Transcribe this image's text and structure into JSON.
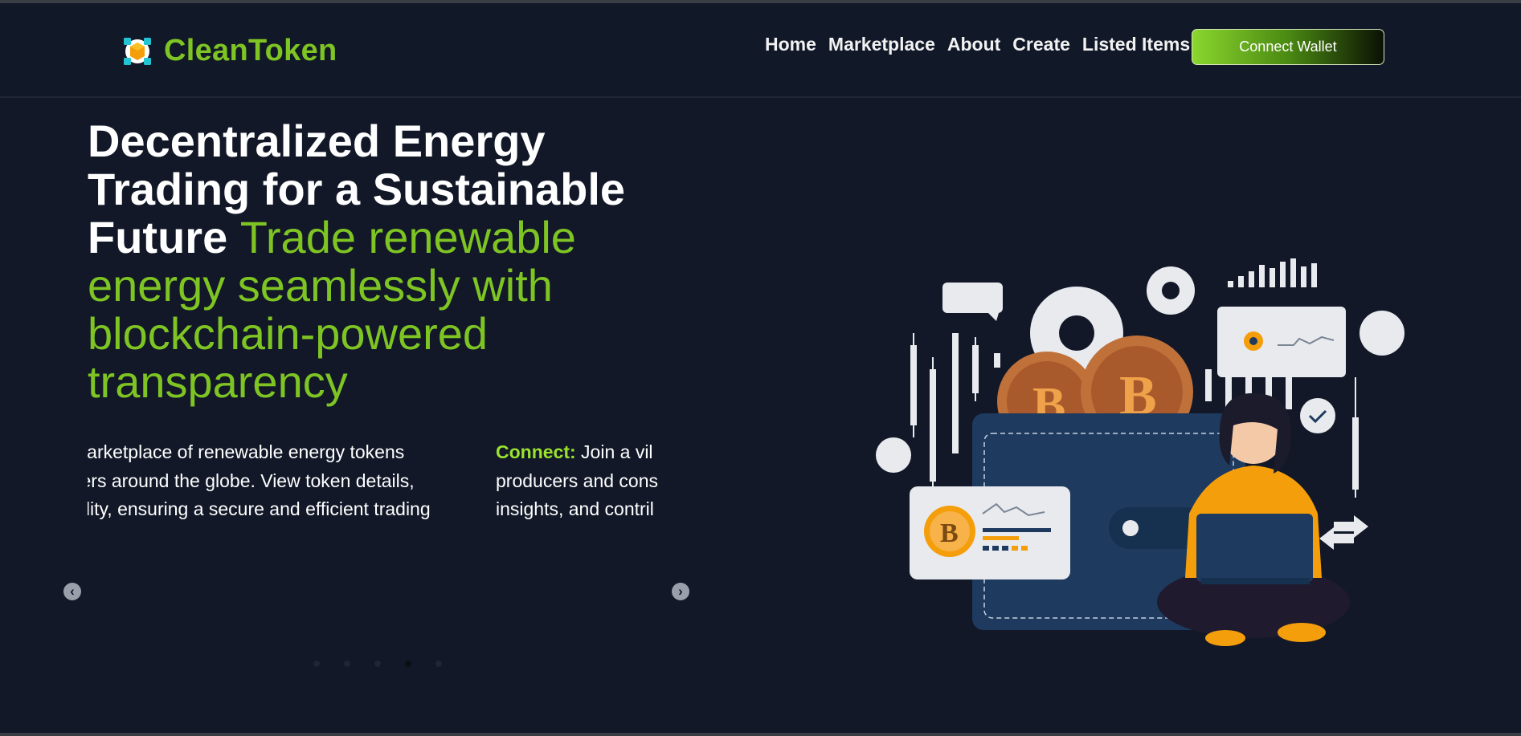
{
  "brand": {
    "name": "CleanToken",
    "icon": "hexagon-cube-icon",
    "color": "#7ec423"
  },
  "nav": {
    "items": [
      {
        "label": "Home"
      },
      {
        "label": "Marketplace"
      },
      {
        "label": "About"
      },
      {
        "label": "Create"
      },
      {
        "label": "Listed Items"
      }
    ],
    "wallet_button": "Connect Wallet"
  },
  "hero": {
    "title": "Decentralized Energy Trading for a Sustainable Future",
    "subtitle": "Trade renewable energy seamlessly with blockchain-powered transparency",
    "slides": [
      {
        "lines": [
          "marketplace of renewable energy tokens",
          "cers around the globe. View token details,",
          "oility, ensuring a secure and efficient trading"
        ]
      },
      {
        "keyword": "Connect:",
        "lines": [
          " Join a vil",
          "producers and cons",
          "insights, and contril"
        ]
      }
    ],
    "prev_icon": "chevron-left-icon",
    "next_icon": "chevron-right-icon",
    "dots_count": 5,
    "active_dot": 3
  },
  "colors": {
    "accent": "#7ec423",
    "background": "#121828",
    "header": "#111827"
  }
}
